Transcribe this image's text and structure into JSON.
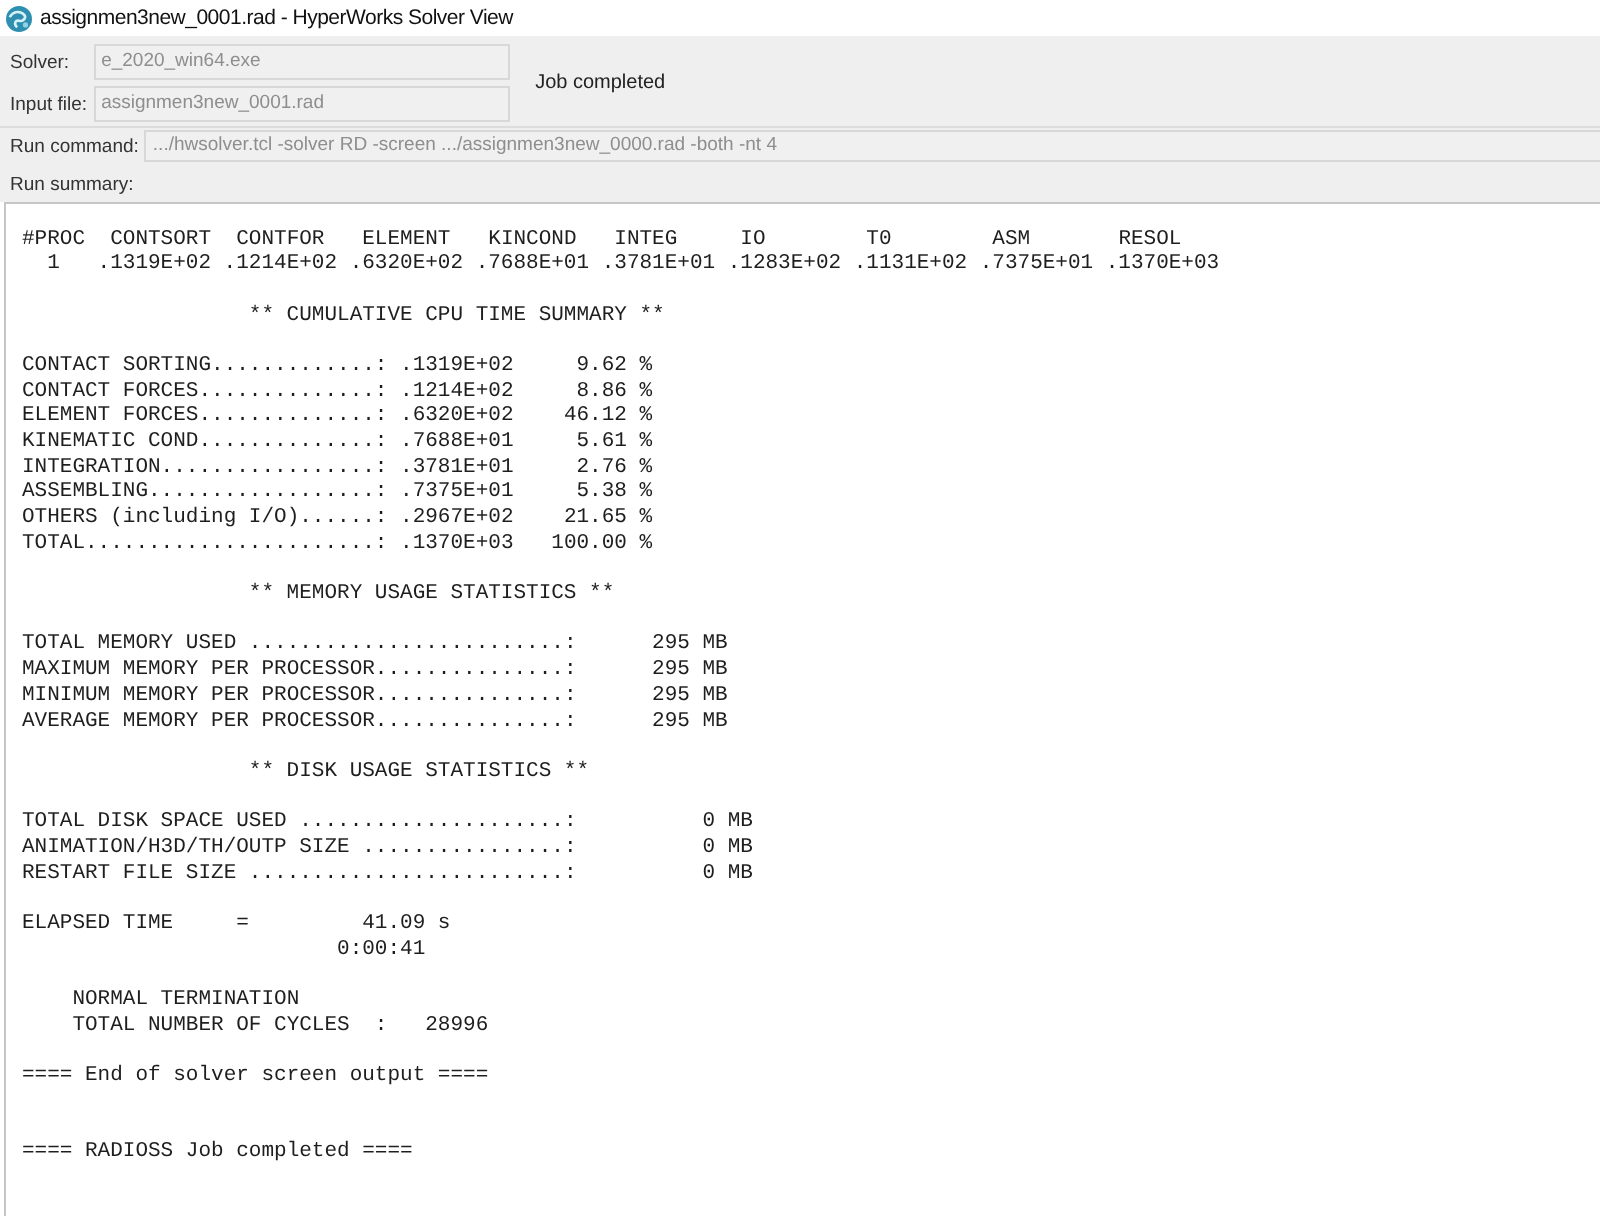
{
  "window": {
    "title": "assignmen3new_0001.rad - HyperWorks Solver View"
  },
  "job": {
    "solver": {
      "label": "Solver:",
      "value": "e_2020_win64.exe",
      "disabled": true
    },
    "input_file": {
      "label": "Input file:",
      "value": "assignmen3new_0001.rad",
      "disabled": true
    },
    "status": "Job completed"
  },
  "run_command": {
    "label": "Run command:",
    "value": ".../hwsolver.tcl -solver RD -screen .../assignmen3new_0000.rad -both -nt 4",
    "disabled": true
  },
  "run_summary": {
    "label": "Run summary:",
    "proc_table": {
      "header": "#PROC  CONTSORT  CONTFOR   ELEMENT   KINCOND   INTEG     IO        T0        ASM       RESOL",
      "row": "1   .1319E+02 .1214E+02 .6320E+02 .7688E+01 .3781E+01 .1283E+02 .1131E+02 .7375E+01 .1370E+03"
    },
    "sections": [
      {
        "title": "** CUMULATIVE CPU TIME SUMMARY **",
        "lines": [
          "CONTACT SORTING.............: .1319E+02     9.62 %",
          "CONTACT FORCES..............: .1214E+02     8.86 %",
          "ELEMENT FORCES..............: .6320E+02    46.12 %",
          "KINEMATIC COND..............: .7688E+01     5.61 %",
          "INTEGRATION.................: .3781E+01     2.76 %",
          "ASSEMBLING..................: .7375E+01     5.38 %",
          "OTHERS (including I/O)......: .2967E+02    21.65 %",
          "TOTAL.......................: .1370E+03   100.00 %"
        ]
      },
      {
        "title": "** MEMORY USAGE STATISTICS **",
        "lines": [
          "TOTAL MEMORY USED .........................:      295 MB",
          "MAXIMUM MEMORY PER PROCESSOR...............:      295 MB",
          "MINIMUM MEMORY PER PROCESSOR...............:      295 MB",
          "AVERAGE MEMORY PER PROCESSOR...............:      295 MB"
        ]
      },
      {
        "title": "** DISK USAGE STATISTICS **",
        "lines": [
          "TOTAL DISK SPACE USED .....................:          0 MB",
          "ANIMATION/H3D/TH/OUTP SIZE ................:          0 MB",
          "RESTART FILE SIZE .........................:          0 MB"
        ]
      }
    ],
    "elapsed": {
      "line": "ELAPSED TIME     =         41.09 s",
      "clock": "0:00:41"
    },
    "termination": [
      "NORMAL TERMINATION",
      "TOTAL NUMBER OF CYCLES  :   28996"
    ],
    "end_message": "==== End of solver screen output ====",
    "job_message": "==== RADIOSS Job completed ===="
  }
}
